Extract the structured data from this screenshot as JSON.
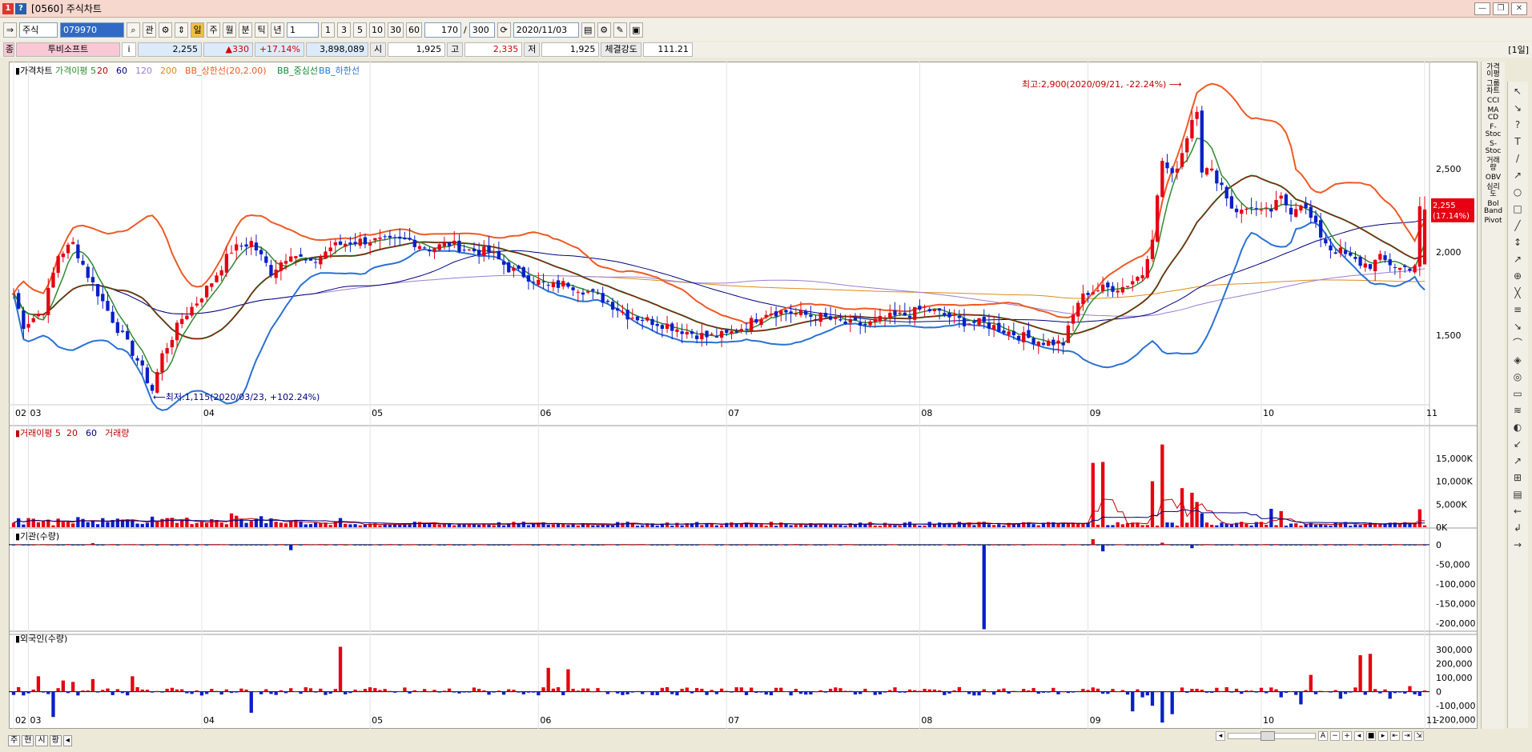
{
  "window": {
    "title": "[0560] 주식차트",
    "minimize": "—",
    "restore": "❐",
    "close": "✕"
  },
  "toolbar": {
    "market": "주식",
    "code": "079970",
    "btn_search": "⌕",
    "btn_gwan": "관",
    "period_buttons": [
      "일",
      "주",
      "월",
      "분",
      "틱",
      "년"
    ],
    "unit_select": "1",
    "interval_buttons": [
      "1",
      "3",
      "5",
      "10",
      "30",
      "60"
    ],
    "count": "170",
    "total": "300",
    "date": "2020/11/03"
  },
  "info": {
    "badge": "종",
    "name": "투비소프트",
    "info_btn": "i",
    "price": "2,255",
    "change": "▲330",
    "change_pct": "+17.14%",
    "volume": "3,898,089",
    "open_label": "시",
    "open": "1,925",
    "high_label": "고",
    "high": "2,335",
    "low_label": "저",
    "low": "1,925",
    "strength_label": "체결강도",
    "strength": "111.21",
    "day_label": "[1일]"
  },
  "panels": {
    "price_legend": [
      {
        "text": "가격차트",
        "color": "#000000"
      },
      {
        "text": "가격이평 5",
        "color": "#2e8b2e"
      },
      {
        "text": "20",
        "color": "#c00000"
      },
      {
        "text": "60",
        "color": "#000080"
      },
      {
        "text": "120",
        "color": "#9b7fd4"
      },
      {
        "text": "200",
        "color": "#e08a1a"
      },
      {
        "text": "BB_상한선(20,2.00)",
        "color": "#ee5a24"
      },
      {
        "text": "BB_중심선",
        "color": "#118833"
      },
      {
        "text": "BB_하한선",
        "color": "#2a72d4"
      }
    ],
    "volume_legend": [
      {
        "text": "거래이평 5",
        "color": "#c00000"
      },
      {
        "text": "20",
        "color": "#c00000"
      },
      {
        "text": "60",
        "color": "#000080"
      },
      {
        "text": "거래량",
        "color": "#c00000"
      }
    ],
    "inst_title": "기관(수량)",
    "foreign_title": "외국인(수량)",
    "annot_high": "최고:2,900(2020/09/21, -22.24%)",
    "annot_low": "최저:1,115(2020/03/23, +102.24%)",
    "current_price": "2,255",
    "current_pct": "(17.14%)"
  },
  "chart_data": {
    "type": "candlestick",
    "months": [
      "02",
      "03",
      "04",
      "05",
      "06",
      "07",
      "08",
      "09",
      "10",
      "11"
    ],
    "month_positions": [
      0,
      3,
      38,
      72,
      106,
      144,
      183,
      217,
      252,
      285
    ],
    "price_axis": {
      "ticks": [
        "2,500",
        "2,000",
        "1,500"
      ],
      "values": [
        2500,
        2000,
        1500
      ],
      "range": [
        1100,
        3000
      ]
    },
    "volume_axis": {
      "ticks": [
        "15,000K",
        "10,000K",
        "5,000K",
        "0K"
      ],
      "values": [
        15000,
        10000,
        5000,
        0
      ],
      "range": [
        0,
        19500
      ]
    },
    "inst_axis": {
      "ticks": [
        "0",
        "-50,000",
        "-100,000",
        "-150,000",
        "-200,000"
      ],
      "values": [
        0,
        -50000,
        -100000,
        -150000,
        -200000
      ],
      "range": [
        -220000,
        20000
      ]
    },
    "foreign_axis": {
      "ticks": [
        "300,000",
        "200,000",
        "100,000",
        "0",
        "-100,000",
        "-200,000"
      ],
      "values": [
        300000,
        200000,
        100000,
        0,
        -100000,
        -200000
      ],
      "range": [
        -230000,
        340000
      ]
    },
    "price_anchors": [
      [
        0,
        1750
      ],
      [
        2,
        1560
      ],
      [
        6,
        1650
      ],
      [
        9,
        1980
      ],
      [
        12,
        2050
      ],
      [
        15,
        1860
      ],
      [
        18,
        1700
      ],
      [
        21,
        1540
      ],
      [
        25,
        1350
      ],
      [
        28,
        1170
      ],
      [
        30,
        1380
      ],
      [
        34,
        1600
      ],
      [
        37,
        1700
      ],
      [
        40,
        1820
      ],
      [
        44,
        2010
      ],
      [
        48,
        2060
      ],
      [
        52,
        1880
      ],
      [
        56,
        2000
      ],
      [
        60,
        1920
      ],
      [
        64,
        2030
      ],
      [
        68,
        2060
      ],
      [
        72,
        2070
      ],
      [
        76,
        2060
      ],
      [
        80,
        2070
      ],
      [
        84,
        2020
      ],
      [
        88,
        2050
      ],
      [
        92,
        2010
      ],
      [
        96,
        2000
      ],
      [
        100,
        1900
      ],
      [
        104,
        1850
      ],
      [
        108,
        1790
      ],
      [
        112,
        1810
      ],
      [
        116,
        1760
      ],
      [
        120,
        1700
      ],
      [
        124,
        1620
      ],
      [
        128,
        1590
      ],
      [
        132,
        1560
      ],
      [
        136,
        1520
      ],
      [
        140,
        1490
      ],
      [
        144,
        1500
      ],
      [
        148,
        1560
      ],
      [
        152,
        1640
      ],
      [
        156,
        1640
      ],
      [
        160,
        1620
      ],
      [
        164,
        1600
      ],
      [
        168,
        1570
      ],
      [
        172,
        1560
      ],
      [
        176,
        1600
      ],
      [
        180,
        1620
      ],
      [
        184,
        1660
      ],
      [
        188,
        1620
      ],
      [
        192,
        1580
      ],
      [
        196,
        1570
      ],
      [
        200,
        1530
      ],
      [
        204,
        1490
      ],
      [
        208,
        1460
      ],
      [
        212,
        1450
      ],
      [
        215,
        1700
      ],
      [
        217,
        1760
      ],
      [
        220,
        1780
      ],
      [
        224,
        1790
      ],
      [
        228,
        1870
      ],
      [
        230,
        2100
      ],
      [
        232,
        2550
      ],
      [
        234,
        2450
      ],
      [
        236,
        2600
      ],
      [
        238,
        2800
      ],
      [
        239,
        2870
      ],
      [
        240,
        2500
      ],
      [
        242,
        2480
      ],
      [
        244,
        2400
      ],
      [
        246,
        2270
      ],
      [
        248,
        2240
      ],
      [
        250,
        2280
      ],
      [
        252,
        2230
      ],
      [
        254,
        2250
      ],
      [
        256,
        2320
      ],
      [
        258,
        2250
      ],
      [
        260,
        2300
      ],
      [
        262,
        2200
      ],
      [
        264,
        2100
      ],
      [
        266,
        2020
      ],
      [
        268,
        2000
      ],
      [
        270,
        1960
      ],
      [
        272,
        1930
      ],
      [
        274,
        1920
      ],
      [
        276,
        1960
      ],
      [
        278,
        1930
      ],
      [
        280,
        1900
      ],
      [
        282,
        1910
      ],
      [
        283,
        1925
      ],
      [
        284,
        2255
      ]
    ],
    "volume_events": [
      [
        218,
        14000
      ],
      [
        220,
        14200
      ],
      [
        230,
        10000
      ],
      [
        232,
        18000
      ],
      [
        236,
        8500
      ],
      [
        238,
        7500
      ],
      [
        239,
        5500
      ],
      [
        240,
        3000
      ],
      [
        230,
        10000
      ],
      [
        44,
        3000
      ],
      [
        45,
        2500
      ],
      [
        66,
        2000
      ],
      [
        254,
        4000
      ],
      [
        256,
        3500
      ],
      [
        284,
        3900
      ]
    ],
    "inst_events": [
      [
        196,
        -215000
      ],
      [
        218,
        14000
      ],
      [
        220,
        -17000
      ],
      [
        16,
        4000
      ],
      [
        56,
        -14000
      ],
      [
        238,
        -9000
      ],
      [
        232,
        5000
      ]
    ],
    "foreign_events": [
      [
        5,
        110000
      ],
      [
        8,
        -180000
      ],
      [
        66,
        320000
      ],
      [
        12,
        70000
      ],
      [
        10,
        80000
      ],
      [
        16,
        90000
      ],
      [
        24,
        110000
      ],
      [
        48,
        -150000
      ],
      [
        108,
        170000
      ],
      [
        112,
        160000
      ],
      [
        226,
        -140000
      ],
      [
        228,
        -40000
      ],
      [
        230,
        -100000
      ],
      [
        232,
        -220000
      ],
      [
        234,
        -160000
      ],
      [
        236,
        30000
      ],
      [
        256,
        -40000
      ],
      [
        260,
        -90000
      ],
      [
        262,
        120000
      ],
      [
        268,
        -50000
      ],
      [
        272,
        260000
      ],
      [
        274,
        270000
      ],
      [
        278,
        -50000
      ],
      [
        282,
        40000
      ],
      [
        284,
        -30000
      ]
    ]
  },
  "sidebar": [
    "가격\n이평",
    "그룹\n차트",
    "CCI",
    "MA\nCD",
    "F-\nStoc",
    "S-\nStoc",
    "거래\n량",
    "OBV",
    "심리\n도",
    "Bol\nBand",
    "Pivot"
  ],
  "tools": [
    "↖",
    "↘",
    "?",
    "T",
    "/",
    "↗",
    "○",
    "□",
    "╱",
    "↕",
    "↗",
    "⊕",
    "╳",
    "≡",
    "↘",
    "⌒",
    "◈",
    "◎",
    "▭",
    "≋",
    "◐",
    "↙",
    "↗",
    "⊞",
    "▤",
    "←",
    "↲",
    "→"
  ],
  "bottom": {
    "tabs": [
      "주",
      "현",
      "시",
      "황"
    ],
    "arrow": "◂"
  }
}
